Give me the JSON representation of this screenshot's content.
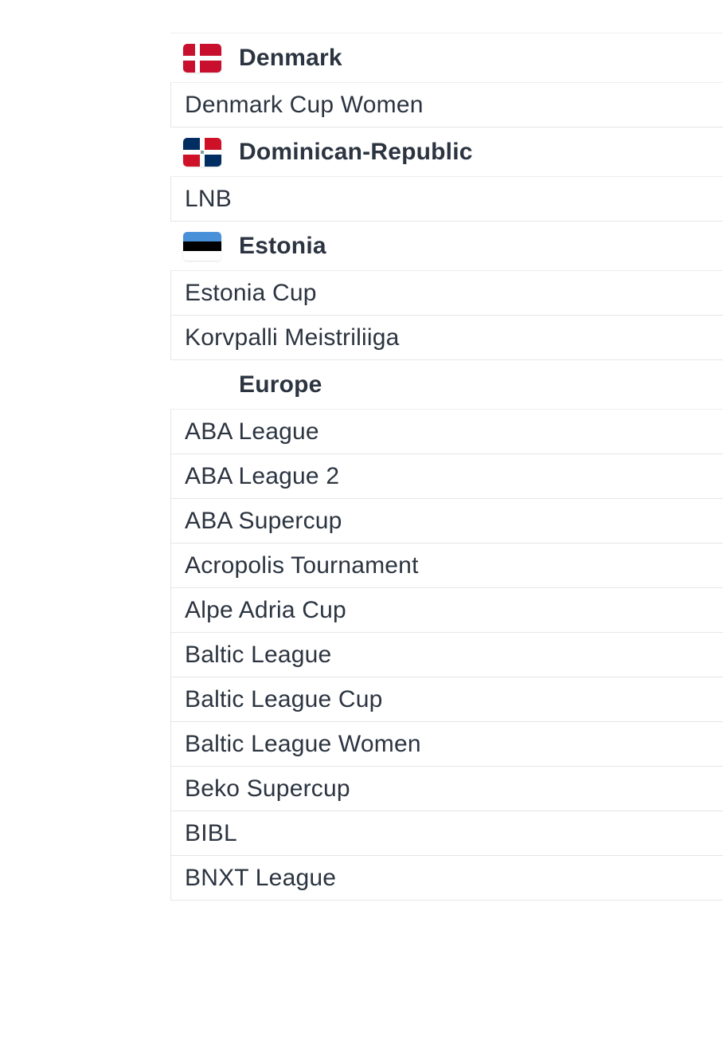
{
  "groups": [
    {
      "country": "Denmark",
      "flag_icon": "denmark-flag-icon",
      "leagues": [
        "Denmark Cup Women"
      ]
    },
    {
      "country": "Dominican-Republic",
      "flag_icon": "dominican-republic-flag-icon",
      "leagues": [
        "LNB"
      ]
    },
    {
      "country": "Estonia",
      "flag_icon": "estonia-flag-icon",
      "leagues": [
        "Estonia Cup",
        "Korvpalli Meistriliiga"
      ]
    },
    {
      "country": "Europe",
      "flag_icon": "",
      "leagues": [
        "ABA League",
        "ABA League 2",
        "ABA Supercup",
        "Acropolis Tournament",
        "Alpe Adria Cup",
        "Baltic League",
        "Baltic League Cup",
        "Baltic League Women",
        "Beko Supercup",
        "BIBL",
        "BNXT League"
      ]
    }
  ],
  "colors": {
    "text": "#2b3440",
    "border": "#e3e6ea",
    "denmark_red": "#c8102e",
    "dominican_blue": "#002d62",
    "dominican_red": "#ce1126",
    "estonia_blue": "#4891d9"
  }
}
